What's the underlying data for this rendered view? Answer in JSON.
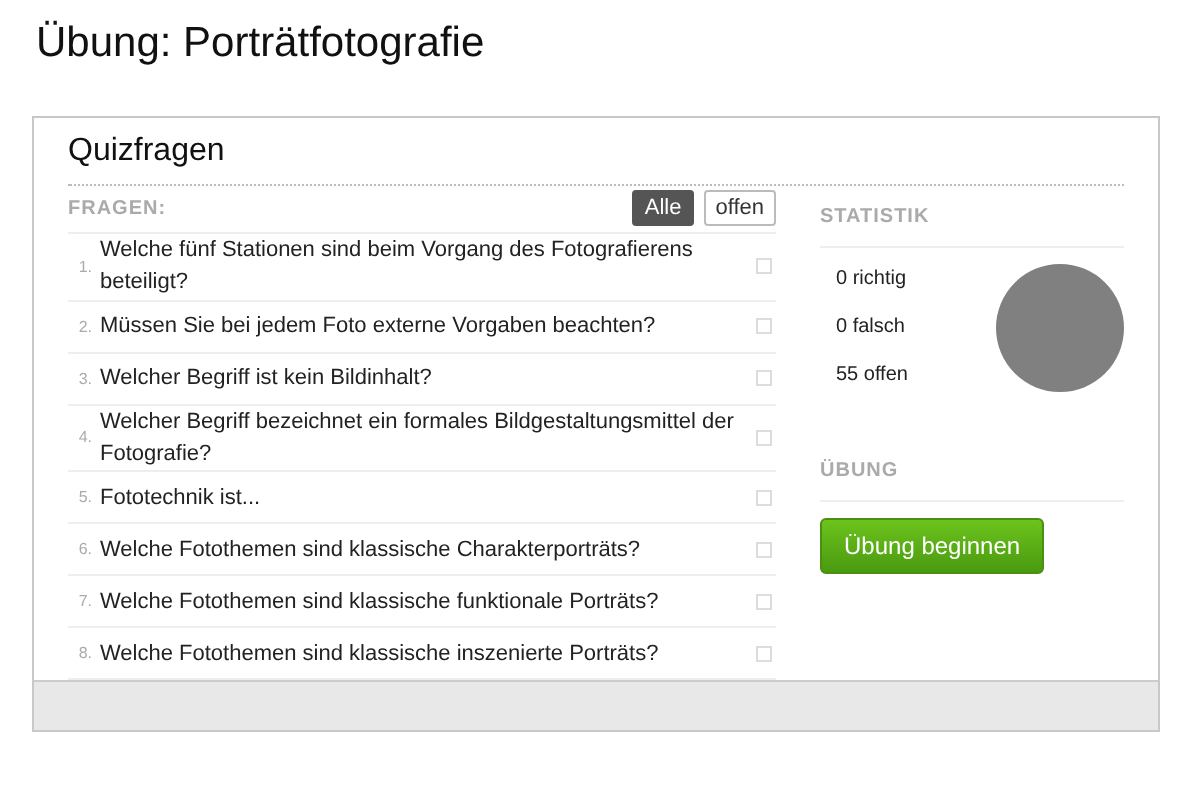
{
  "page_title": "Übung: Porträtfotografie",
  "card": {
    "title": "Quizfragen",
    "questions_header": "FRAGEN:",
    "filters": [
      {
        "label": "Alle",
        "selected": true
      },
      {
        "label": "offen",
        "selected": false
      }
    ],
    "questions": [
      {
        "number": "1.",
        "text": "Welche fünf Stationen sind beim Vorgang des Fotografierens beteiligt?",
        "checked": false
      },
      {
        "number": "2.",
        "text": "Müssen Sie bei jedem Foto externe Vorgaben beachten?",
        "checked": false
      },
      {
        "number": "3.",
        "text": "Welcher Begriff ist kein Bildinhalt?",
        "checked": false
      },
      {
        "number": "4.",
        "text": "Welcher Begriff bezeichnet ein formales Bildgestaltungsmittel der Fotografie?",
        "checked": false
      },
      {
        "number": "5.",
        "text": "Fototechnik ist...",
        "checked": false
      },
      {
        "number": "6.",
        "text": "Welche Fotothemen sind klassische Charakterporträts?",
        "checked": false
      },
      {
        "number": "7.",
        "text": "Welche Fotothemen sind klassische funktionale Porträts?",
        "checked": false
      },
      {
        "number": "8.",
        "text": "Welche Fotothemen sind klassische inszenierte Porträts?",
        "checked": false
      }
    ],
    "statistics": {
      "header": "STATISTIK",
      "lines": [
        "0 richtig",
        "0 falsch",
        "55 offen"
      ]
    },
    "exercise": {
      "header": "ÜBUNG",
      "button": "Übung beginnen"
    }
  }
}
